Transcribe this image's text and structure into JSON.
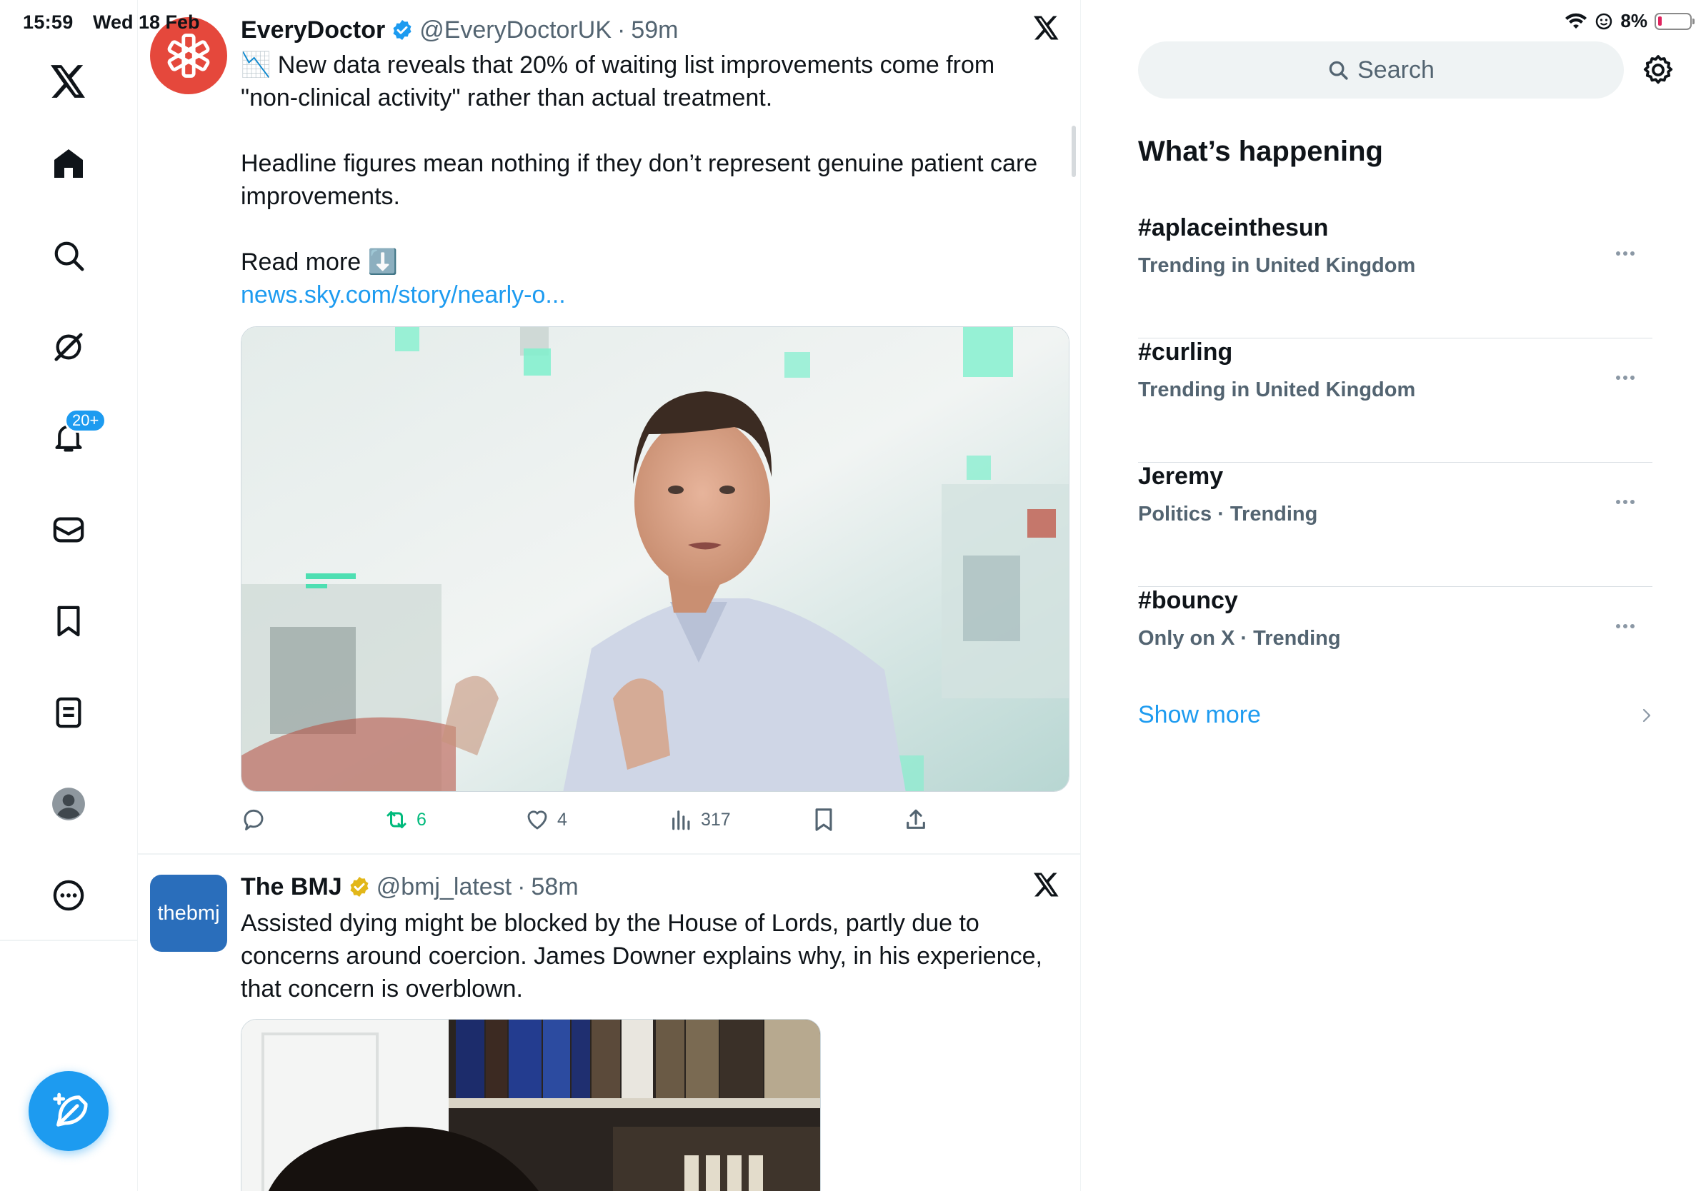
{
  "status_bar": {
    "time": "15:59",
    "date": "Wed 18 Feb",
    "battery": "8%"
  },
  "nav": {
    "notifications_badge": "20+",
    "items": [
      "x-logo",
      "home",
      "explore",
      "grok",
      "notifications",
      "messages",
      "bookmarks",
      "lists",
      "profile",
      "more"
    ]
  },
  "tweets": [
    {
      "name": "EveryDoctor",
      "handle": "@EveryDoctorUK",
      "separator": "·",
      "time": "59m",
      "verified": "blue",
      "emoji_lead": "📉",
      "text_1": "New data reveals that 20% of waiting list improvements come from \"non-clinical activity\" rather than actual treatment.",
      "text_2": "Headline figures mean nothing if they don’t represent genuine patient care improvements.",
      "text_3": "Read more ⬇️",
      "link": "news.sky.com/story/nearly-o...",
      "retweets": "6",
      "likes": "4",
      "views": "317"
    },
    {
      "name": "The BMJ",
      "handle": "@bmj_latest",
      "separator": "·",
      "time": "58m",
      "verified": "gold",
      "avatar_text": "thebmj",
      "text_1": "Assisted dying might be blocked by the House of Lords, partly due to concerns around coercion. James Downer explains why, in his experience, that concern is overblown."
    }
  ],
  "sidebar": {
    "search_placeholder": "Search",
    "title": "What’s happening",
    "trends": [
      {
        "name": "#aplaceinthesun",
        "meta": "Trending in United Kingdom"
      },
      {
        "name": "#curling",
        "meta": "Trending in United Kingdom"
      },
      {
        "name": "Jeremy",
        "meta": "Politics · Trending"
      },
      {
        "name": "#bouncy",
        "meta": "Only on X · Trending"
      }
    ],
    "show_more": "Show more"
  },
  "colors": {
    "accent": "#1d9bf0",
    "retweet_green": "#00ba7c",
    "secondary_text": "#536471",
    "everydoctor_avatar": "#e5483c",
    "bmj_avatar": "#2a6ebb"
  }
}
